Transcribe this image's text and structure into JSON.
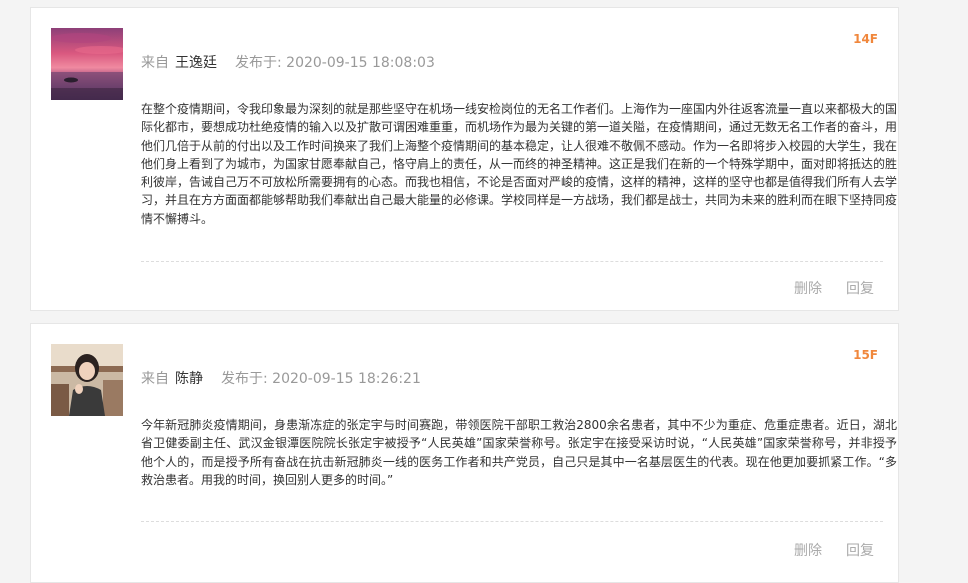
{
  "comments": [
    {
      "floor": "14F",
      "from_label": "来自",
      "author": "王逸廷",
      "posted_label": "发布于:",
      "time": "2020-09-15 18:08:03",
      "content": "在整个疫情期间，令我印象最为深刻的就是那些坚守在机场一线安检岗位的无名工作者们。上海作为一座国内外往返客流量一直以来都极大的国际化都市，要想成功杜绝疫情的输入以及扩散可谓困难重重，而机场作为最为关键的第一道关隘，在疫情期间，通过无数无名工作者的奋斗，用他们几倍于从前的付出以及工作时间换来了我们上海整个疫情期间的基本稳定，让人很难不敬佩不感动。作为一名即将步入校园的大学生，我在他们身上看到了为城市，为国家甘愿奉献自己，恪守肩上的责任，从一而终的神圣精神。这正是我们在新的一个特殊学期中，面对即将抵达的胜利彼岸，告诫自己万不可放松所需要拥有的心态。而我也相信，不论是否面对严峻的疫情，这样的精神，这样的坚守也都是值得我们所有人去学习，并且在方方面面都能够帮助我们奉献出自己最大能量的必修课。学校同样是一方战场，我们都是战士，共同为未来的胜利而在眼下坚持同疫情不懈搏斗。",
      "delete_label": "删除",
      "reply_label": "回复"
    },
    {
      "floor": "15F",
      "from_label": "来自",
      "author": "陈静",
      "posted_label": "发布于:",
      "time": "2020-09-15 18:26:21",
      "content": "今年新冠肺炎疫情期间，身患渐冻症的张定宇与时间赛跑，带领医院干部职工救治2800余名患者，其中不少为重症、危重症患者。近日，湖北省卫健委副主任、武汉金银潭医院院长张定宇被授予“人民英雄”国家荣誉称号。张定宇在接受采访时说，“人民英雄”国家荣誉称号，并非授予他个人的，而是授予所有奋战在抗击新冠肺炎一线的医务工作者和共产党员，自己只是其中一名基层医生的代表。现在他更加要抓紧工作。“多救治患者。用我的时间，换回别人更多的时间。”",
      "delete_label": "删除",
      "reply_label": "回复"
    }
  ]
}
